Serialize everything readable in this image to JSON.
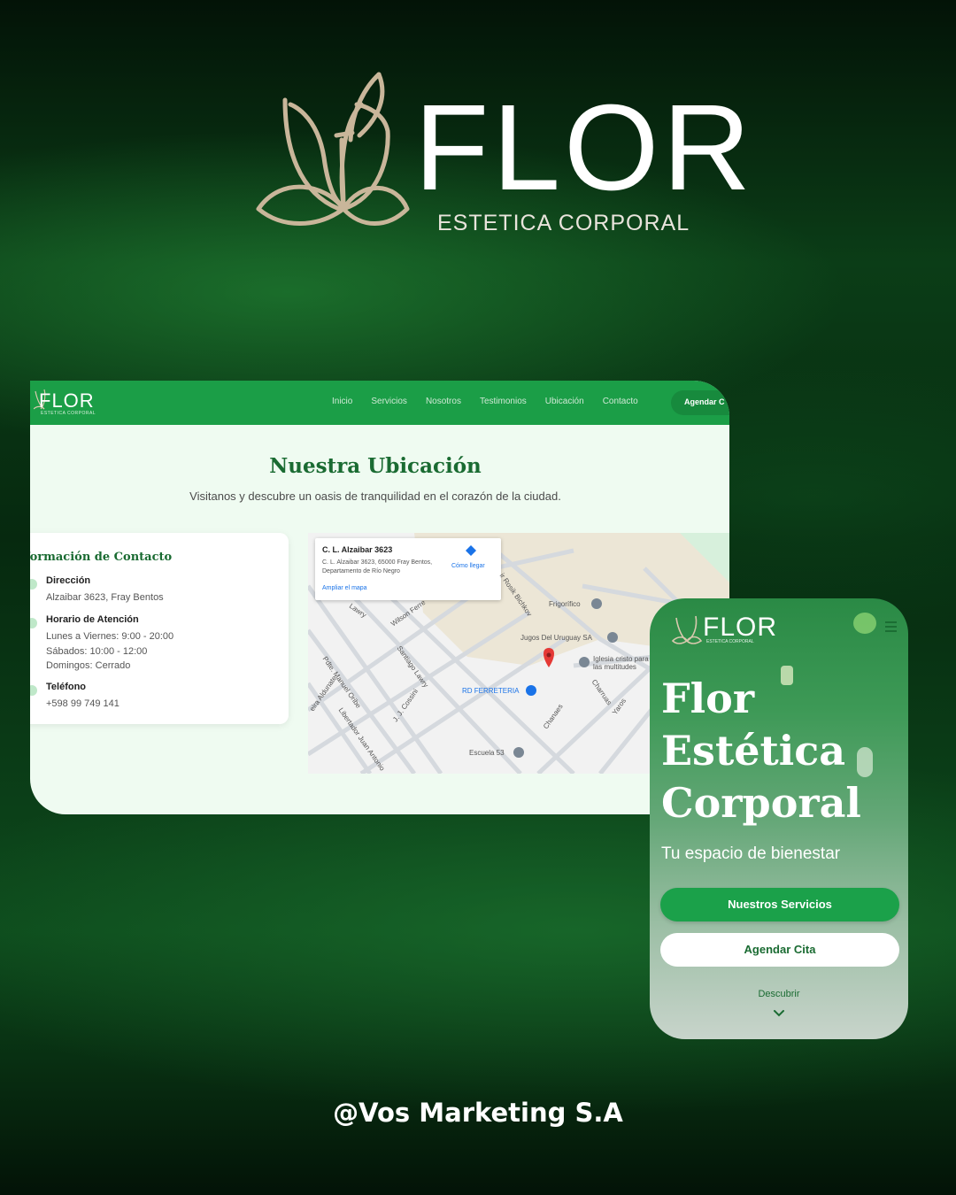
{
  "hero": {
    "brand": "FLOR",
    "tagline": "ESTETICA CORPORAL"
  },
  "desktop": {
    "nav": {
      "logo_brand": "FLOR",
      "logo_sub": "ESTETICA CORPORAL",
      "links": [
        "Inicio",
        "Servicios",
        "Nosotros",
        "Testimonios",
        "Ubicación",
        "Contacto"
      ],
      "cta": "Agendar C"
    },
    "section_title": "Nuestra Ubicación",
    "section_subtitle": "Visitanos y descubre un oasis de tranquilidad en el corazón de la ciudad.",
    "contact": {
      "heading": "formación de Contacto",
      "address_label": "Dirección",
      "address_value": "Alzaibar 3623, Fray Bentos",
      "hours_label": "Horario de Atención",
      "hours_lines": [
        "Lunes a Viernes: 9:00 - 20:00",
        "Sábados: 10:00 - 12:00",
        "Domingos: Cerrado"
      ],
      "phone_label": "Teléfono",
      "phone_value": "+598 99 749 141"
    },
    "map": {
      "popup_title": "C. L. Alzaibar 3623",
      "popup_address": "C. L. Alzaibar 3623, 65000 Fray Bentos, Departamento de Río Negro",
      "popup_directions": "Cómo llegar",
      "popup_enlarge": "Ampliar el mapa",
      "places": {
        "frigorifico": "Frigorífico",
        "jugos": "Jugos Del Uruguay SA",
        "iglesia": "Iglesia cristo para las multitudes",
        "ferreteria": "RD FERRETERIA",
        "escuela": "Escuela 53"
      },
      "streets": {
        "rosik": "ir Rosik Bichkov",
        "wilson": "Wilson Ferre",
        "lawry": "Lawry",
        "santiago": "Santiago Lawry",
        "cossini": "J. J. Cossini",
        "pdte": "Pdte. Manuel Oribe",
        "libertador": "Libertador Juan Antonio",
        "charruas": "Charruas",
        "yaros": "Yaros",
        "chanaes": "Chanaes",
        "aldunate": "eira Aldunate"
      }
    }
  },
  "mobile": {
    "logo_brand": "FLOR",
    "logo_sub": "ESTETICA CORPORAL",
    "title_lines": [
      "Flor",
      "Estética",
      "Corporal"
    ],
    "tagline": "Tu espacio de bienestar",
    "btn_primary": "Nuestros Servicios",
    "btn_secondary": "Agendar Cita",
    "discover": "Descubrir"
  },
  "footer": {
    "credit": "@Vos Marketing S.A"
  },
  "colors": {
    "brand_green": "#1b9e47",
    "dark_green": "#1a6b32",
    "logo_gold": "#c9b69a",
    "background": "#041a09"
  }
}
